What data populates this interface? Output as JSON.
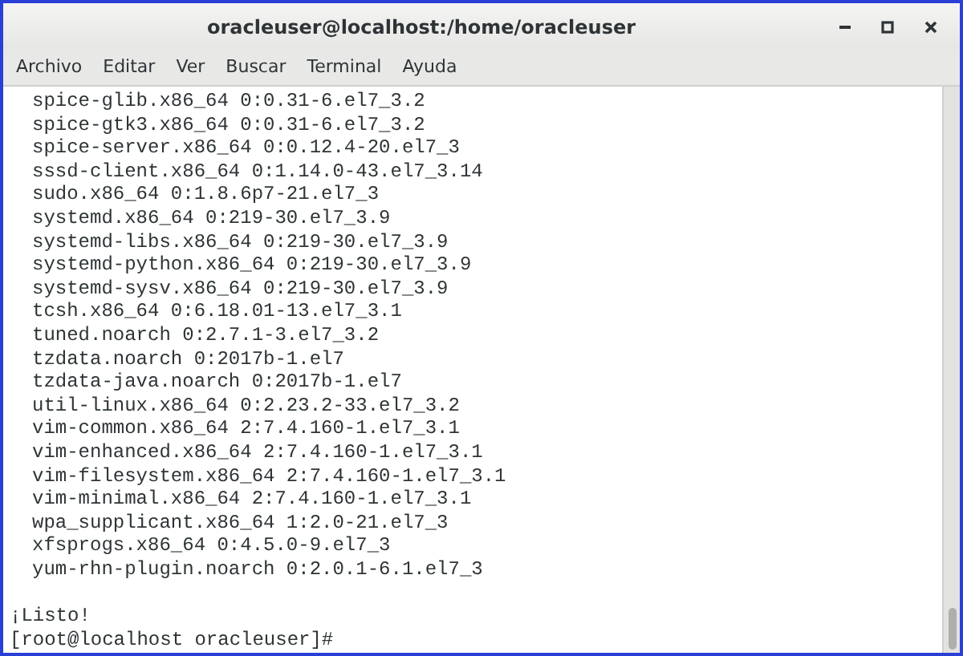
{
  "window": {
    "title": "oracleuser@localhost:/home/oracleuser"
  },
  "menu": [
    "Archivo",
    "Editar",
    "Ver",
    "Buscar",
    "Terminal",
    "Ayuda"
  ],
  "terminal": {
    "output_lines": [
      "spice-glib.x86_64 0:0.31-6.el7_3.2",
      "spice-gtk3.x86_64 0:0.31-6.el7_3.2",
      "spice-server.x86_64 0:0.12.4-20.el7_3",
      "sssd-client.x86_64 0:1.14.0-43.el7_3.14",
      "sudo.x86_64 0:1.8.6p7-21.el7_3",
      "systemd.x86_64 0:219-30.el7_3.9",
      "systemd-libs.x86_64 0:219-30.el7_3.9",
      "systemd-python.x86_64 0:219-30.el7_3.9",
      "systemd-sysv.x86_64 0:219-30.el7_3.9",
      "tcsh.x86_64 0:6.18.01-13.el7_3.1",
      "tuned.noarch 0:2.7.1-3.el7_3.2",
      "tzdata.noarch 0:2017b-1.el7",
      "tzdata-java.noarch 0:2017b-1.el7",
      "util-linux.x86_64 0:2.23.2-33.el7_3.2",
      "vim-common.x86_64 2:7.4.160-1.el7_3.1",
      "vim-enhanced.x86_64 2:7.4.160-1.el7_3.1",
      "vim-filesystem.x86_64 2:7.4.160-1.el7_3.1",
      "vim-minimal.x86_64 2:7.4.160-1.el7_3.1",
      "wpa_supplicant.x86_64 1:2.0-21.el7_3",
      "xfsprogs.x86_64 0:4.5.0-9.el7_3",
      "yum-rhn-plugin.noarch 0:2.0.1-6.1.el7_3"
    ],
    "status": "¡Listo!",
    "prompt": "[root@localhost oracleuser]#"
  }
}
